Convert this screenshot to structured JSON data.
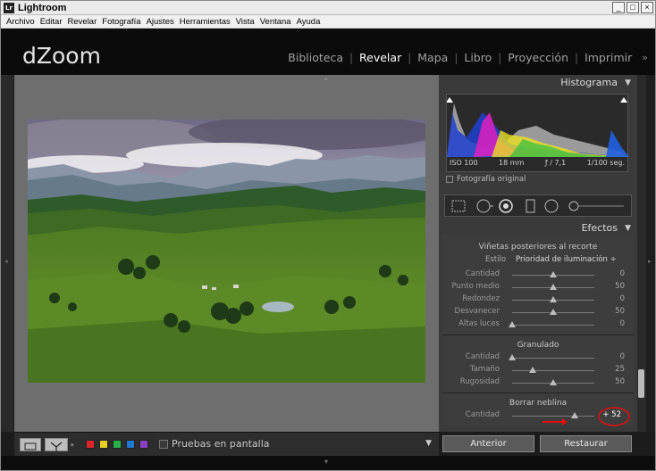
{
  "app": {
    "title": "Lightroom",
    "icon_text": "Lr"
  },
  "window_controls": {
    "minimize": "_",
    "maximize": "□",
    "close": "×"
  },
  "menu": [
    "Archivo",
    "Editar",
    "Revelar",
    "Fotografía",
    "Ajustes",
    "Herramientas",
    "Vista",
    "Ventana",
    "Ayuda"
  ],
  "identity": {
    "logo": "dZoom"
  },
  "modules": [
    {
      "label": "Biblioteca",
      "active": false
    },
    {
      "label": "Revelar",
      "active": true
    },
    {
      "label": "Mapa",
      "active": false
    },
    {
      "label": "Libro",
      "active": false
    },
    {
      "label": "Proyección",
      "active": false
    },
    {
      "label": "Imprimir",
      "active": false
    }
  ],
  "histogram": {
    "title": "Histograma",
    "iso": "ISO 100",
    "focal": "18 mm",
    "aperture": "ƒ / 7,1",
    "shutter": "1/100 seg.",
    "original_photo": "Fotografía original"
  },
  "effects": {
    "title": "Efectos",
    "vignette": {
      "title": "Viñetas posteriores al recorte",
      "style_label": "Estilo",
      "style_value": "Prioridad de iluminación ÷",
      "sliders": [
        {
          "label": "Cantidad",
          "value": "0",
          "pos": 0.5
        },
        {
          "label": "Punto medio",
          "value": "50",
          "pos": 0.5
        },
        {
          "label": "Redondez",
          "value": "0",
          "pos": 0.5
        },
        {
          "label": "Desvanecer",
          "value": "50",
          "pos": 0.5
        },
        {
          "label": "Altas luces",
          "value": "0",
          "pos": 0.0
        }
      ]
    },
    "grain": {
      "title": "Granulado",
      "sliders": [
        {
          "label": "Cantidad",
          "value": "0",
          "pos": 0.0
        },
        {
          "label": "Tamaño",
          "value": "25",
          "pos": 0.25
        },
        {
          "label": "Rugosidad",
          "value": "50",
          "pos": 0.5
        }
      ]
    },
    "dehaze": {
      "title": "Borrar neblina",
      "sliders": [
        {
          "label": "Cantidad",
          "value": "+ 52",
          "pos": 0.76
        }
      ]
    }
  },
  "buttons": {
    "previous": "Anterior",
    "reset": "Restaurar"
  },
  "filmstrip_toolbar": {
    "soft_proof": "Pruebas en pantalla",
    "color_labels": [
      "#d9262b",
      "#e8d21f",
      "#28b14a",
      "#1f78d1",
      "#8a3fc6"
    ]
  }
}
